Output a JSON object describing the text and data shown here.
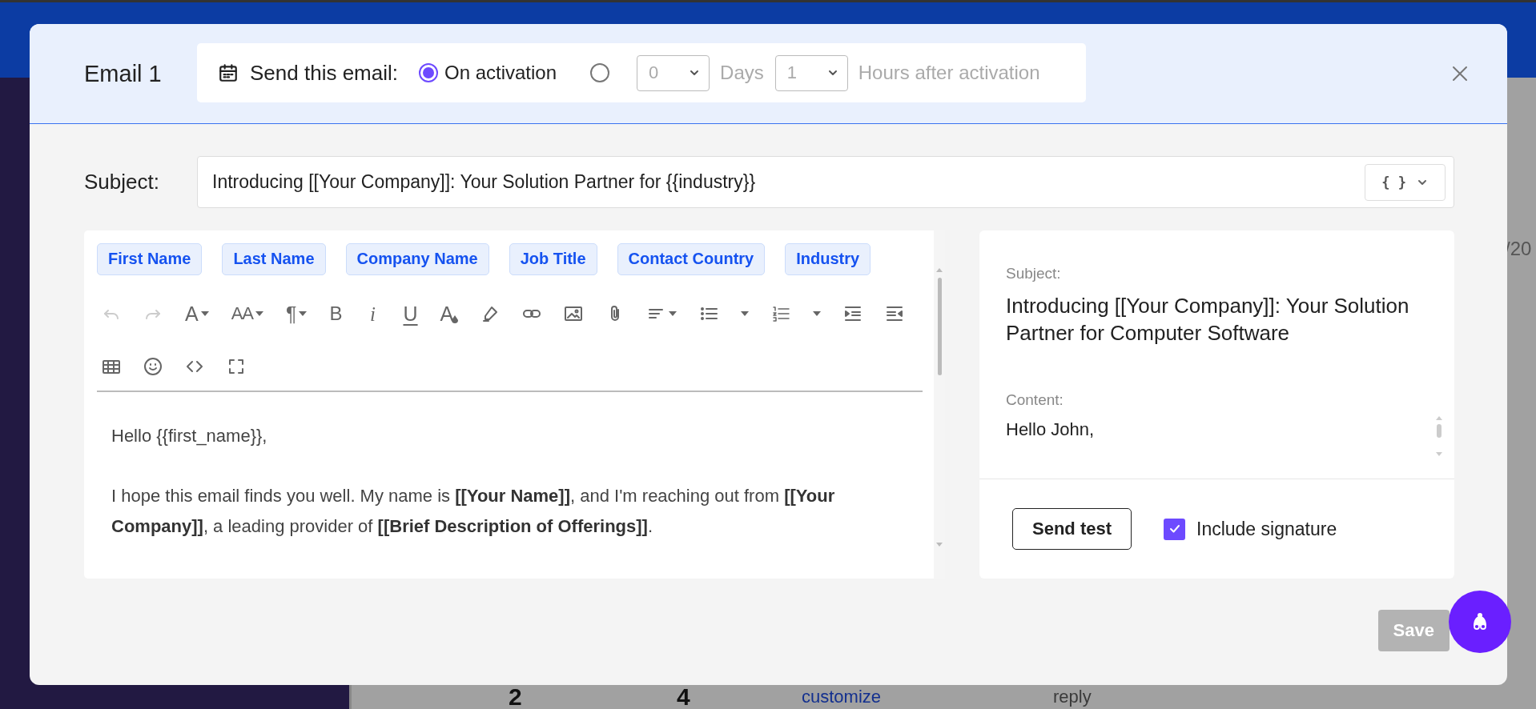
{
  "modal": {
    "title": "Email 1",
    "schedule": {
      "label": "Send this email:",
      "options": [
        {
          "kind": "immediate",
          "label": "On activation",
          "selected": true
        },
        {
          "kind": "delayed",
          "selected": false,
          "days": "0",
          "days_label": "Days",
          "hours": "1",
          "hours_label": "Hours after activation"
        }
      ]
    },
    "subject": {
      "label": "Subject:",
      "value": "Introducing [[Your Company]]: Your Solution Partner for {{industry}}",
      "variables_button": "{ }"
    },
    "editor": {
      "chips": [
        "First Name",
        "Last Name",
        "Company Name",
        "Job Title",
        "Contact Country",
        "Industry"
      ],
      "toolbar": [
        [
          {
            "kind": "undo",
            "disabled": true
          },
          {
            "kind": "redo",
            "disabled": true
          },
          {
            "kind": "font",
            "text": "A",
            "dropdown": true
          },
          {
            "kind": "font-size",
            "text": "AA",
            "dropdown": true
          },
          {
            "kind": "paragraph",
            "text": "¶",
            "dropdown": true
          },
          {
            "kind": "bold",
            "text": "B"
          },
          {
            "kind": "italic",
            "text": "i"
          },
          {
            "kind": "underline",
            "text": "U"
          },
          {
            "kind": "text-color",
            "text": "A"
          },
          {
            "kind": "highlighter"
          },
          {
            "kind": "link"
          },
          {
            "kind": "image"
          },
          {
            "kind": "attachment"
          },
          {
            "kind": "align",
            "dropdown": true
          },
          {
            "kind": "bullet-list"
          },
          {
            "kind": "caret"
          },
          {
            "kind": "numbered-list"
          },
          {
            "kind": "caret"
          },
          {
            "kind": "indent"
          },
          {
            "kind": "outdent"
          }
        ],
        [
          {
            "kind": "table"
          },
          {
            "kind": "emoji"
          },
          {
            "kind": "code"
          },
          {
            "kind": "fullscreen"
          }
        ]
      ],
      "body": [
        "Hello {{first_name}},",
        "I hope this email finds you well. My name is **[[Your Name]]**, and I'm reaching out from **[[Your Company]]**, a leading provider of **[[Brief Description of Offerings]]**."
      ]
    },
    "preview": {
      "subject_label": "Subject:",
      "subject": "Introducing [[Your Company]]: Your Solution Partner for Computer Software",
      "content_label": "Content:",
      "content": "Hello John,",
      "send_test": "Send test",
      "include_signature": {
        "label": "Include signature",
        "checked": true
      }
    },
    "save": {
      "label": "Save",
      "disabled": true
    }
  },
  "background": {
    "date_fragment": "/20",
    "counts": [
      "2",
      "4"
    ],
    "link": "customize",
    "text": "reply"
  }
}
